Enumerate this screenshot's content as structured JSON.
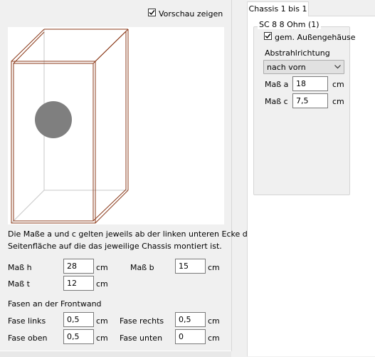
{
  "preview_checkbox": {
    "label": "Vorschau zeigen",
    "checked": true
  },
  "description": {
    "line1": "Die Maße a und c gelten jeweils ab der linken unteren Ecke der",
    "line2": "Seitenfläche auf die das jeweilige Chassis montiert ist."
  },
  "dimensions": {
    "h": {
      "label": "Maß h",
      "value": "28",
      "unit": "cm"
    },
    "b": {
      "label": "Maß b",
      "value": "15",
      "unit": "cm"
    },
    "t": {
      "label": "Maß t",
      "value": "12",
      "unit": "cm"
    }
  },
  "chamfer": {
    "heading": "Fasen an der Frontwand",
    "links": {
      "label": "Fase links",
      "value": "0,5",
      "unit": "cm"
    },
    "rechts": {
      "label": "Fase rechts",
      "value": "0,5",
      "unit": "cm"
    },
    "oben": {
      "label": "Fase oben",
      "value": "0,5",
      "unit": "cm"
    },
    "unten": {
      "label": "Fase unten",
      "value": "0",
      "unit": "cm"
    }
  },
  "tab": {
    "label": "Chassis 1 bis 1"
  },
  "chassis_group": {
    "title": "SC 8 8 Ohm (1)",
    "external_housing": {
      "label": "gem. Außengehäuse",
      "checked": true
    },
    "direction_label": "Abstrahlrichtung",
    "direction_value": "nach vorn",
    "a": {
      "label": "Maß a",
      "value": "18",
      "unit": "cm"
    },
    "c": {
      "label": "Maß c",
      "value": "7,5",
      "unit": "cm"
    }
  },
  "colors": {
    "box_edge": "#8b3a1a",
    "hidden_edge": "#c8c8c8",
    "speaker": "#7f7f7f"
  }
}
